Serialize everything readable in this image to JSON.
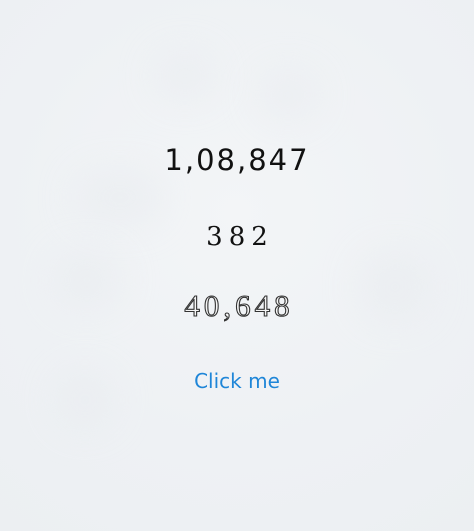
{
  "numbers": {
    "first": "1,08,847",
    "second": "382",
    "third": "40,648"
  },
  "action": {
    "label": "Click me"
  },
  "colors": {
    "background": "#f0f2f4",
    "text": "#111111",
    "link": "#1f86d8"
  }
}
